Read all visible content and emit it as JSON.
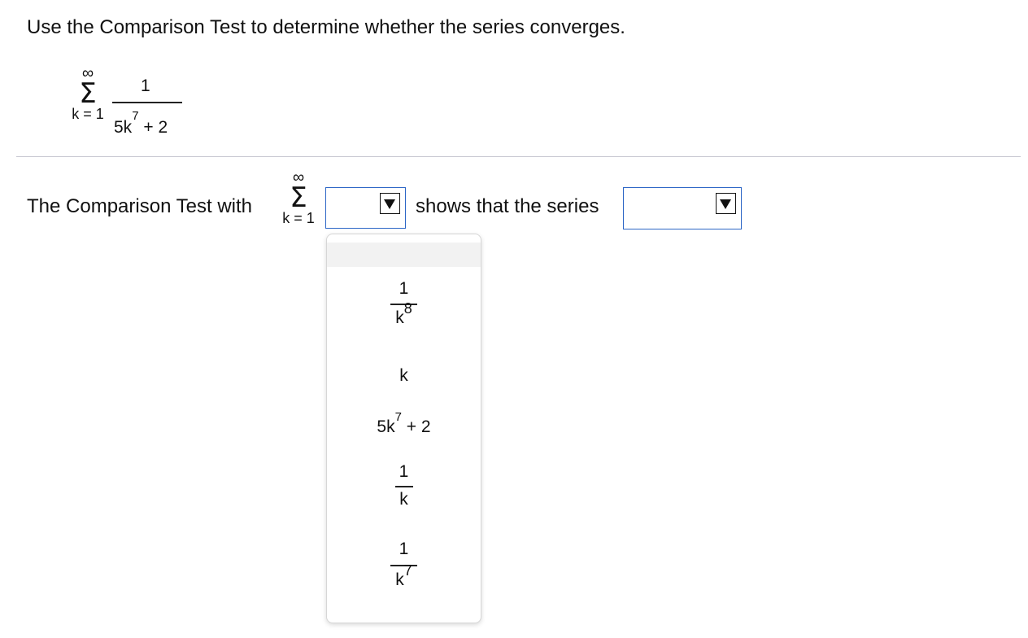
{
  "question": {
    "prompt": "Use the Comparison Test to determine whether the series converges.",
    "series": {
      "upper": "∞",
      "symbol": "Σ",
      "lower": "k = 1",
      "numerator": "1",
      "denominator_base": "5k",
      "denominator_exp": "7",
      "denominator_tail": "+ 2"
    }
  },
  "answer": {
    "lead_text": "The Comparison Test with",
    "sum_upper": "∞",
    "sum_symbol": "Σ",
    "sum_lower": "k = 1",
    "select1_value": "",
    "middle_text": "shows that the series",
    "select2_value": ""
  },
  "dropdown": {
    "options": [
      {
        "label": "",
        "kind": "blank"
      },
      {
        "numerator": "1",
        "base": "k",
        "exp": "8"
      },
      {
        "label": "k"
      },
      {
        "base": "5k",
        "exp": "7",
        "tail": "+ 2"
      },
      {
        "numerator": "1",
        "base": "k"
      },
      {
        "numerator": "1",
        "base": "k",
        "exp": "7"
      }
    ]
  }
}
